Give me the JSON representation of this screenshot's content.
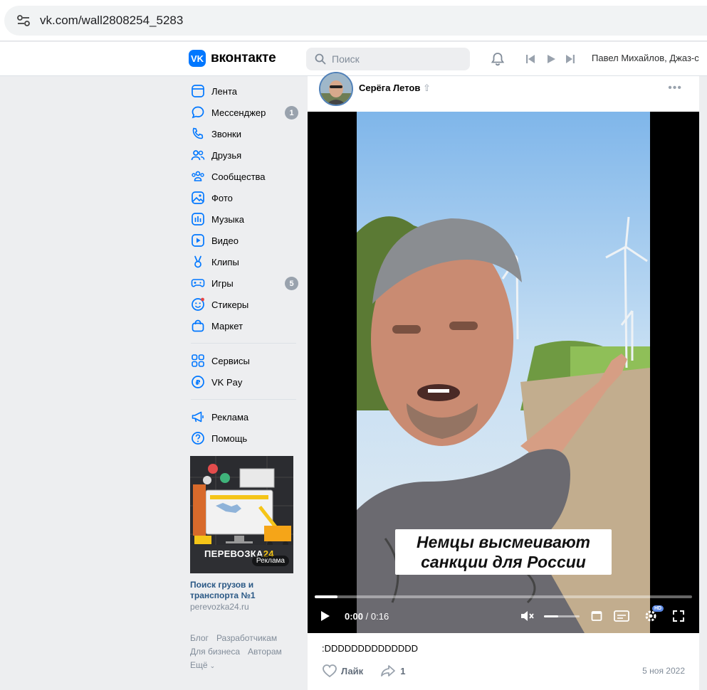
{
  "browser": {
    "url": "vk.com/wall2808254_5283"
  },
  "header": {
    "logo_text": "вконтакте",
    "logo_letter": "VK",
    "search_placeholder": "Поиск",
    "user_label": "Павел Михайлов, Джаз-с"
  },
  "sidebar": {
    "items": [
      {
        "label": "Лента",
        "icon": "news-icon"
      },
      {
        "label": "Мессенджер",
        "icon": "chat-icon",
        "badge": "1"
      },
      {
        "label": "Звонки",
        "icon": "phone-icon"
      },
      {
        "label": "Друзья",
        "icon": "friends-icon"
      },
      {
        "label": "Сообщества",
        "icon": "communities-icon"
      },
      {
        "label": "Фото",
        "icon": "photo-icon"
      },
      {
        "label": "Музыка",
        "icon": "music-icon"
      },
      {
        "label": "Видео",
        "icon": "video-icon"
      },
      {
        "label": "Клипы",
        "icon": "clips-icon"
      },
      {
        "label": "Игры",
        "icon": "games-icon",
        "badge": "5"
      },
      {
        "label": "Стикеры",
        "icon": "stickers-icon"
      },
      {
        "label": "Маркет",
        "icon": "market-icon"
      }
    ],
    "services": [
      {
        "label": "Сервисы",
        "icon": "services-icon"
      },
      {
        "label": "VK Pay",
        "icon": "vkpay-icon"
      }
    ],
    "extra": [
      {
        "label": "Реклама",
        "icon": "megaphone-icon"
      },
      {
        "label": "Помощь",
        "icon": "help-icon"
      }
    ],
    "ad": {
      "brand": "ПЕРЕВОЗКА",
      "brand_num": "24",
      "tag": "Реклама",
      "title": "Поиск грузов и транспорта №1",
      "domain": "perevozka24.ru"
    },
    "footer": {
      "blog": "Блог",
      "developers": "Разработчикам",
      "business": "Для бизнеса",
      "authors": "Авторам",
      "more": "Ещё"
    }
  },
  "post": {
    "author": "Серёга Летов",
    "caption_line1": "Немцы высмеивают",
    "caption_line2": "санкции для России",
    "time_current": "0:00",
    "time_total": "0:16",
    "hd_badge": "HD",
    "progress": 0.06,
    "text": ":DDDDDDDDDDDDDD",
    "like_label": "Лайк",
    "share_count": "1",
    "date": "5 ноя 2022"
  },
  "colors": {
    "accent": "#0077ff",
    "link": "#2a5885",
    "badge": "#99a2ad"
  }
}
